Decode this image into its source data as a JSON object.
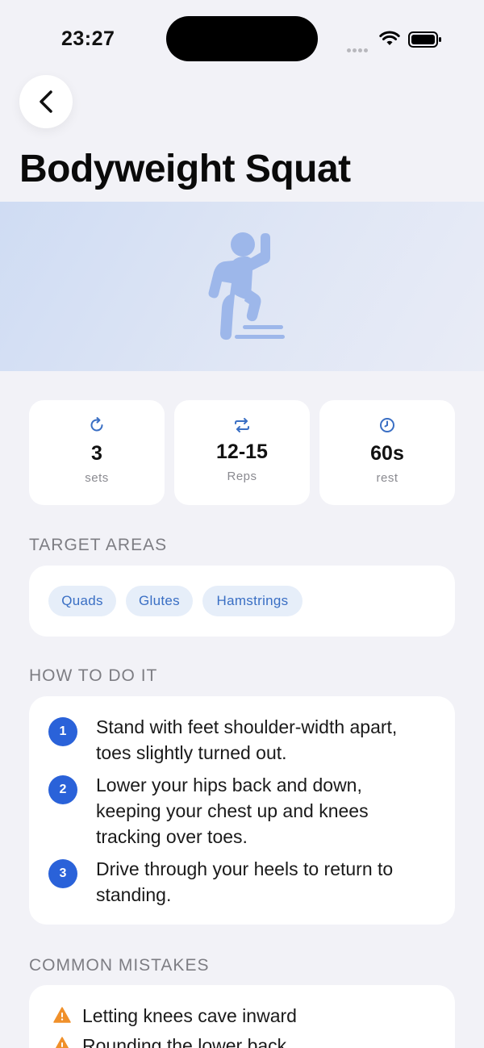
{
  "status": {
    "time": "23:27"
  },
  "header": {
    "title": "Bodyweight Squat",
    "back_icon": "chevron-left-icon"
  },
  "hero": {
    "icon": "step-up-exercise-icon",
    "color": "#9db7ea"
  },
  "stats": [
    {
      "icon": "refresh-icon",
      "value": "3",
      "label": "sets"
    },
    {
      "icon": "repeat-icon",
      "value": "12-15",
      "label": "Reps"
    },
    {
      "icon": "clock-icon",
      "value": "60s",
      "label": "rest"
    }
  ],
  "target_areas": {
    "label": "TARGET AREAS",
    "chips": [
      "Quads",
      "Glutes",
      "Hamstrings"
    ]
  },
  "how_to": {
    "label": "HOW TO DO IT",
    "steps": [
      {
        "num": "1",
        "text": "Stand with feet shoulder-width apart, toes slightly turned out."
      },
      {
        "num": "2",
        "text": "Lower your hips back and down, keeping your chest up and knees tracking over toes."
      },
      {
        "num": "3",
        "text": "Drive through your heels to return to standing."
      }
    ]
  },
  "mistakes": {
    "label": "COMMON MISTAKES",
    "items": [
      "Letting knees cave inward",
      "Rounding the lower back"
    ]
  },
  "colors": {
    "accent": "#2a62d9",
    "warning": "#f0902a",
    "background": "#f2f2f7"
  }
}
